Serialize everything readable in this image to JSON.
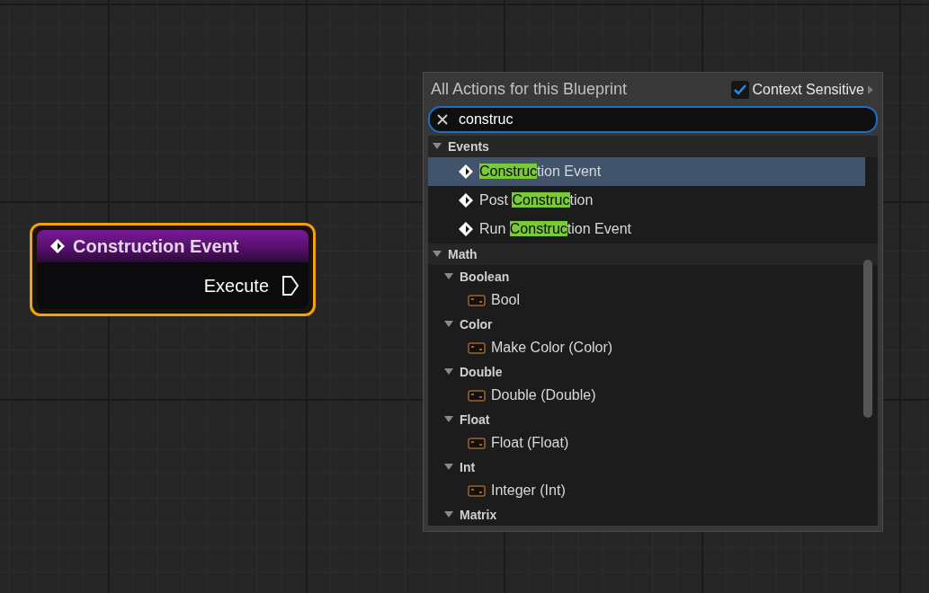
{
  "node": {
    "title": "Construction Event",
    "pin": "Execute",
    "selected": true
  },
  "menu": {
    "title": "All Actions for this Blueprint",
    "context_sensitive": {
      "label": "Context Sensitive",
      "checked": true
    },
    "search": {
      "value": "construc"
    },
    "tree": [
      {
        "label": "Events",
        "expanded": true,
        "children": [
          {
            "kind": "event",
            "match": "Construc",
            "after": "tion Event",
            "selected": true
          },
          {
            "kind": "event",
            "before": "Post ",
            "match": "Construc",
            "after": "tion",
            "selected": false
          },
          {
            "kind": "event",
            "before": "Run ",
            "match": "Construc",
            "after": "tion Event",
            "selected": false
          }
        ]
      },
      {
        "label": "Math",
        "expanded": true,
        "children": [
          {
            "kind": "category",
            "label": "Boolean",
            "expanded": true,
            "children": [
              {
                "kind": "function",
                "label": "Bool",
                "selected": false
              }
            ]
          },
          {
            "kind": "category",
            "label": "Color",
            "expanded": true,
            "children": [
              {
                "kind": "function",
                "label": "Make Color (Color)",
                "selected": false
              }
            ]
          },
          {
            "kind": "category",
            "label": "Double",
            "expanded": true,
            "children": [
              {
                "kind": "function",
                "label": "Double (Double)",
                "selected": false
              }
            ]
          },
          {
            "kind": "category",
            "label": "Float",
            "expanded": true,
            "children": [
              {
                "kind": "function",
                "label": "Float (Float)",
                "selected": false
              }
            ]
          },
          {
            "kind": "category",
            "label": "Int",
            "expanded": true,
            "children": [
              {
                "kind": "function",
                "label": "Integer (Int)",
                "selected": false
              }
            ]
          },
          {
            "kind": "category",
            "label": "Matrix",
            "expanded": true
          }
        ]
      }
    ]
  }
}
